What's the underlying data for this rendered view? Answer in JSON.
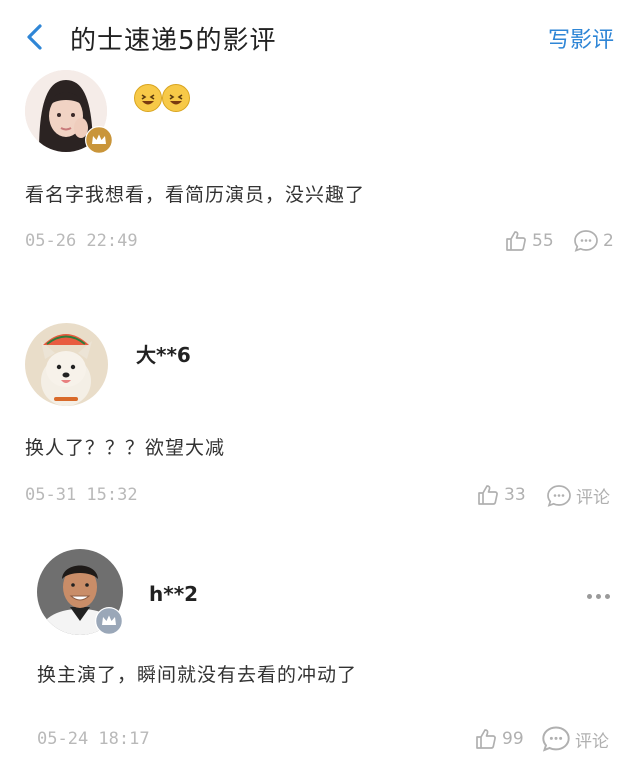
{
  "header": {
    "title": "的士速递5的影评",
    "write_label": "写影评"
  },
  "colors": {
    "accent": "#2f86d6",
    "meta": "#b9b9b9",
    "badge_gold": "#d9a440",
    "badge_silver": "#9aa7b8"
  },
  "reviews": [
    {
      "username": "",
      "emoji": "😆😆",
      "content": "看名字我想看，看简历演员，没兴趣了",
      "time": "05-26 22:49",
      "likes": "55",
      "comments": "2",
      "badge": "crown-gold"
    },
    {
      "username": "大**6",
      "content": "换人了？？？欲望大减",
      "time": "05-31 15:32",
      "likes": "33",
      "comments": "评论"
    },
    {
      "username": "h**2",
      "content": "换主演了，瞬间就没有去看的冲动了",
      "time": "05-24 18:17",
      "likes": "99",
      "comments": "评论",
      "badge": "crown-silver"
    }
  ]
}
